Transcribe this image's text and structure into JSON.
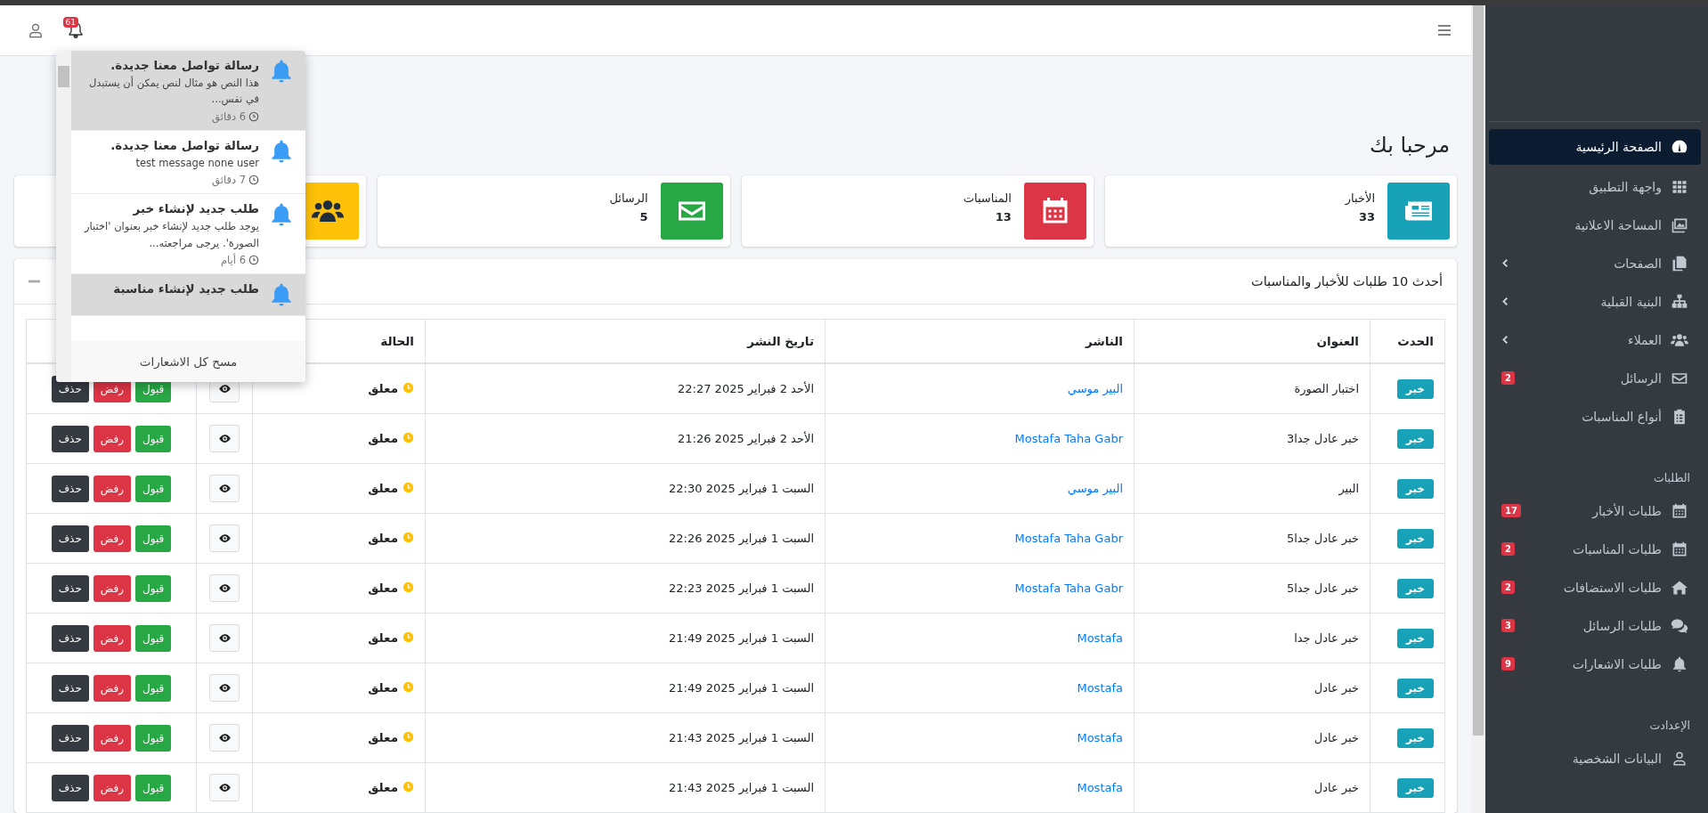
{
  "header": {
    "notifications_count": "61"
  },
  "notifications": {
    "items": [
      {
        "title": "رسالة تواصل معنا جديدة.",
        "body": "هذا النص هو مثال لنص يمكن أن يستبدل في نفس...",
        "time": "6 دقائق",
        "unread": true
      },
      {
        "title": "رسالة تواصل معنا جديدة.",
        "body": "test message none user",
        "time": "7 دقائق",
        "unread": false
      },
      {
        "title": "طلب جديد لإنشاء خبر",
        "body": "يوجد طلب جديد لإنشاء خبر بعنوان 'اختبار الصورة'. يرجى مراجعته...",
        "time": "6 أيام",
        "unread": false
      },
      {
        "title": "طلب جديد لإنشاء مناسبة",
        "unread": true
      }
    ],
    "footer": "مسح كل الاشعارات"
  },
  "page_title": "مرحبا بك",
  "stats": [
    {
      "kind": "news",
      "label": "الأخبار",
      "value": "33",
      "color": "#17a2b8"
    },
    {
      "kind": "calendar",
      "label": "المناسبات",
      "value": "13",
      "color": "#dc3545"
    },
    {
      "kind": "envelope",
      "label": "الرسائل",
      "value": "5",
      "color": "#28a745"
    },
    {
      "kind": "users",
      "color": "#ffc107"
    }
  ],
  "requests": {
    "title": "أحدث 10 طلبات للأخبار والمناسبات",
    "columns": [
      "الحدث",
      "العنوان",
      "الناشر",
      "تاريخ النشر",
      "الحالة"
    ],
    "rows": [
      {
        "type": "خبر",
        "title": "اختبار الصورة",
        "publisher": "البير موسي",
        "date": "الأحد 2 فبراير 2025 22:27",
        "status": "معلق",
        "actions": [
          {
            "kind": "accept",
            "label": "قبول"
          },
          {
            "kind": "reject",
            "label": "رفض"
          },
          {
            "kind": "delete",
            "label": "حذف"
          }
        ]
      },
      {
        "type": "خبر",
        "title": "خبر عادل جدا3",
        "publisher": "Mostafa Taha Gabr",
        "date": "الأحد 2 فبراير 2025 21:26",
        "status": "معلق",
        "actions": [
          {
            "kind": "accept",
            "label": "قبول"
          },
          {
            "kind": "reject",
            "label": "رفض"
          },
          {
            "kind": "delete",
            "label": "حذف"
          }
        ]
      },
      {
        "type": "خبر",
        "title": "البير",
        "publisher": "البير موسي",
        "date": "السبت 1 فبراير 2025 22:30",
        "status": "معلق",
        "actions": [
          {
            "kind": "accept",
            "label": "قبول"
          },
          {
            "kind": "reject",
            "label": "رفض"
          },
          {
            "kind": "delete",
            "label": "حذف"
          }
        ]
      },
      {
        "type": "خبر",
        "title": "خبر عادل جدا5",
        "publisher": "Mostafa Taha Gabr",
        "date": "السبت 1 فبراير 2025 22:26",
        "status": "معلق",
        "actions": [
          {
            "kind": "accept",
            "label": "قبول"
          },
          {
            "kind": "reject",
            "label": "رفض"
          },
          {
            "kind": "delete",
            "label": "حذف"
          }
        ]
      },
      {
        "type": "خبر",
        "title": "خبر عادل جدا5",
        "publisher": "Mostafa Taha Gabr",
        "date": "السبت 1 فبراير 2025 22:23",
        "status": "معلق",
        "actions": [
          {
            "kind": "accept",
            "label": "قبول"
          },
          {
            "kind": "reject",
            "label": "رفض"
          },
          {
            "kind": "delete",
            "label": "حذف"
          }
        ]
      },
      {
        "type": "خبر",
        "title": "خبر عادل جدا",
        "publisher": "Mostafa",
        "date": "السبت 1 فبراير 2025 21:49",
        "status": "معلق",
        "actions": [
          {
            "kind": "accept",
            "label": "قبول"
          },
          {
            "kind": "reject",
            "label": "رفض"
          },
          {
            "kind": "delete",
            "label": "حذف"
          }
        ]
      },
      {
        "type": "خبر",
        "title": "خبر عادل",
        "publisher": "Mostafa",
        "date": "السبت 1 فبراير 2025 21:49",
        "status": "معلق",
        "actions": [
          {
            "kind": "accept",
            "label": "قبول"
          },
          {
            "kind": "reject",
            "label": "رفض"
          },
          {
            "kind": "delete",
            "label": "حذف"
          }
        ]
      },
      {
        "type": "خبر",
        "title": "خبر عادل",
        "publisher": "Mostafa",
        "date": "السبت 1 فبراير 2025 21:43",
        "status": "معلق",
        "actions": [
          {
            "kind": "accept",
            "label": "قبول"
          },
          {
            "kind": "reject",
            "label": "رفض"
          },
          {
            "kind": "delete",
            "label": "حذف"
          }
        ]
      },
      {
        "type": "خبر",
        "title": "خبر عادل",
        "publisher": "Mostafa",
        "date": "السبت 1 فبراير 2025 21:43",
        "status": "معلق",
        "actions": [
          {
            "kind": "accept",
            "label": "قبول"
          },
          {
            "kind": "reject",
            "label": "رفض"
          },
          {
            "kind": "delete",
            "label": "حذف"
          }
        ]
      }
    ]
  },
  "sidebar": {
    "sections": [
      {
        "items": [
          {
            "label": "الصفحة الرئيسية",
            "kind": "dashboard",
            "selected": true,
            "expandable": false
          },
          {
            "label": "واجهة التطبيق",
            "kind": "grid",
            "selected": false,
            "expandable": false
          },
          {
            "label": "المساحة الاعلانية",
            "kind": "images",
            "selected": false,
            "expandable": false
          },
          {
            "label": "الصفحات",
            "kind": "copy",
            "selected": false,
            "expandable": true
          },
          {
            "label": "البنية القبلية",
            "kind": "sitemap",
            "selected": false,
            "expandable": true
          },
          {
            "label": "العملاء",
            "kind": "users",
            "selected": false,
            "expandable": true
          },
          {
            "label": "الرسائل",
            "kind": "envelope",
            "selected": false,
            "expandable": false,
            "badge": "2"
          },
          {
            "label": "أنواع المناسبات",
            "kind": "clipboard",
            "selected": false,
            "expandable": false
          }
        ]
      },
      {
        "heading": "الطلبات",
        "items": [
          {
            "label": "طلبات الأخبار",
            "kind": "calendar",
            "selected": false,
            "expandable": false,
            "badge": "17"
          },
          {
            "label": "طلبات المناسبات",
            "kind": "calendar",
            "selected": false,
            "expandable": false,
            "badge": "2"
          },
          {
            "label": "طلبات الاستضافات",
            "kind": "home",
            "selected": false,
            "expandable": false,
            "badge": "2"
          },
          {
            "label": "طلبات الرسائل",
            "kind": "comments",
            "selected": false,
            "expandable": false,
            "badge": "3"
          },
          {
            "label": "طلبات الاشعارات",
            "kind": "bell",
            "selected": false,
            "expandable": false,
            "badge": "9"
          }
        ]
      },
      {
        "heading": "الإعدادت",
        "items": [
          {
            "label": "البيانات الشخصية",
            "kind": "user",
            "selected": false,
            "expandable": false
          }
        ]
      }
    ]
  }
}
